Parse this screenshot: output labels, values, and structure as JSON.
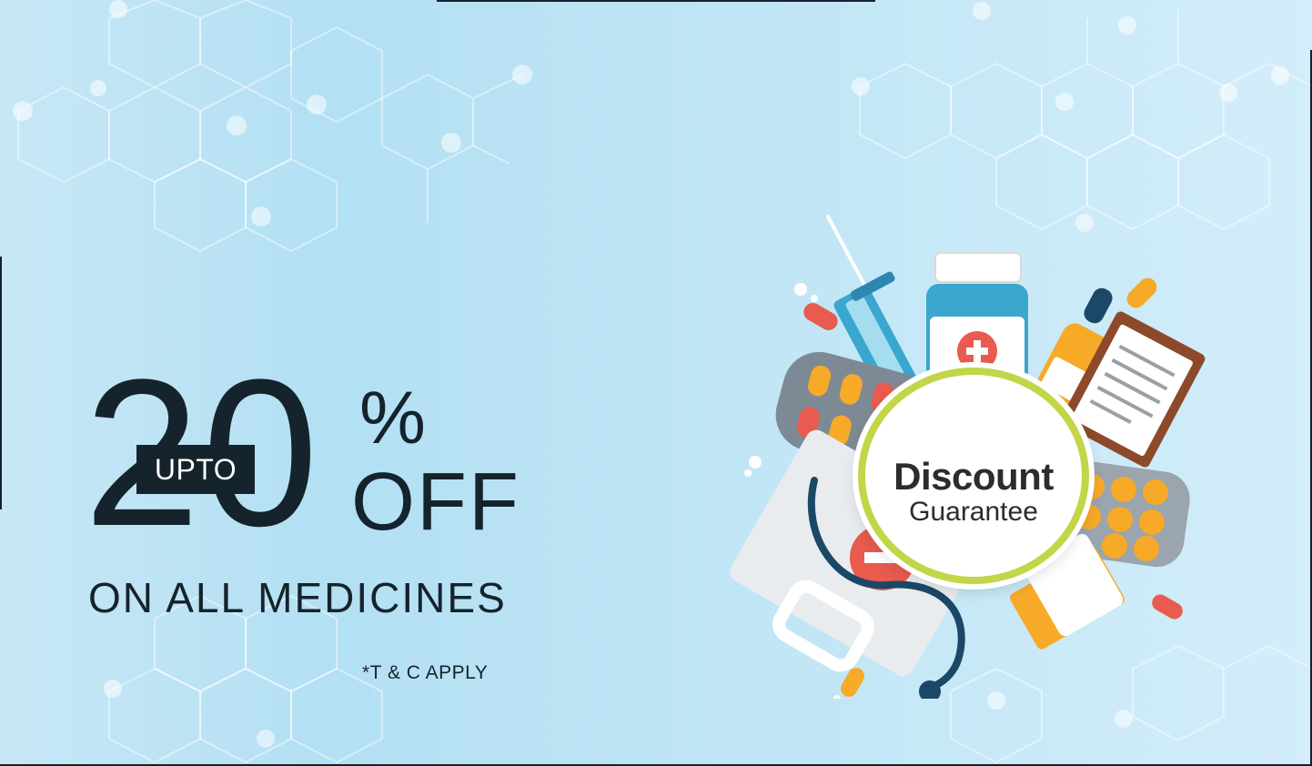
{
  "promo": {
    "digit_tens": "2",
    "digit_ones": "0",
    "upto_label": "UPTO",
    "percent_sign": "%",
    "off_label": "OFF",
    "headline": "ON ALL MEDICINES",
    "terms": "*T & C APPLY"
  },
  "seal": {
    "line1": "Discount",
    "line2": "Guarantee"
  },
  "colors": {
    "text_dark": "#15232c",
    "background_light": "#d3edfa",
    "background_mid": "#b3e0f3",
    "seal_ring": "#c3d548",
    "pill_red": "#e85b4e",
    "pill_orange": "#f7a928",
    "bottle_teal": "#3aa7cf"
  },
  "illustration": {
    "icons": [
      "syringe-icon",
      "medicine-bottle-icon",
      "dropper-icon",
      "clipboard-icon",
      "pill-blister-icon",
      "first-aid-kit-icon",
      "stethoscope-icon",
      "pill-bottle-icon",
      "capsule-icon"
    ]
  }
}
